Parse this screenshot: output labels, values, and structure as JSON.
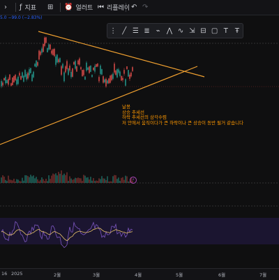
{
  "toolbar": {
    "items": [
      {
        "label": "",
        "icon": "chevron-icon"
      },
      {
        "label": "지표",
        "icon": "indicators-icon"
      },
      {
        "label": "",
        "icon": "layout-icon"
      },
      {
        "label": "얼러트",
        "icon": "alert-clock-icon"
      },
      {
        "label": "리플레이",
        "icon": "replay-icon"
      }
    ],
    "undo_icon": "undo-icon",
    "redo_icon": "redo-icon"
  },
  "price_info": {
    "text": "5.0 −99.0 (−2.83%)"
  },
  "drawing_toolbar": {
    "tools": [
      "drag-handle-icon",
      "trendline-icon",
      "horizontal-lines-icon",
      "fib-icon",
      "path-icon",
      "pattern-icon",
      "wave-icon",
      "ruler-icon",
      "position-icon",
      "rectangle-icon",
      "text-icon",
      "note-icon"
    ]
  },
  "annotation": {
    "lines": [
      "날봉",
      "상승 추세선",
      "하락 추세선의 삼각수렴",
      "저 안에서 움직이다가 큰 하락이나 큰 상승이 동반 될거 같습니다"
    ]
  },
  "xaxis": {
    "labels": [
      "16",
      "2025",
      "2월",
      "3월",
      "4월",
      "5월",
      "6월",
      "7월"
    ]
  },
  "colors": {
    "up": "#26a69a",
    "down": "#ef5350",
    "trend": "#f0a030",
    "rsi": "#7e57c2",
    "rsi_ma": "#e8c26a",
    "price_line": "#ef5350"
  }
}
